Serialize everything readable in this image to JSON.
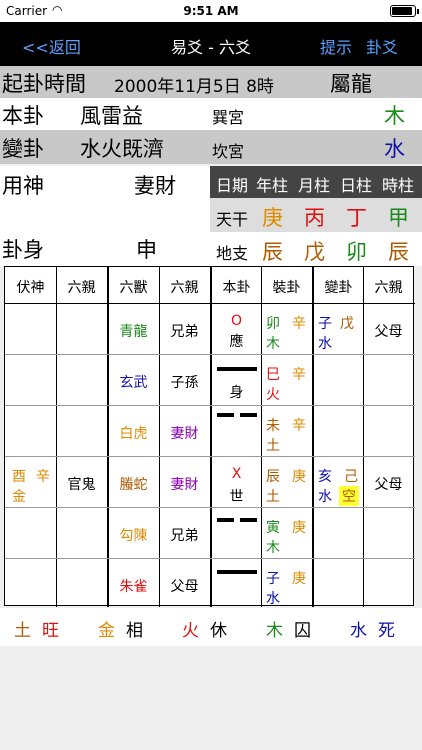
{
  "status": {
    "carrier": "Carrier",
    "time": "9:51 AM"
  },
  "nav": {
    "back": "<<返回",
    "title": "易爻 - 六爻",
    "hint": "提示",
    "gua_yao": "卦爻"
  },
  "info": {
    "time_label": "起卦時間",
    "time_value": "2000年11月5日 8時",
    "zodiac": "屬龍",
    "bengua_label": "本卦",
    "bengua_value": "風雷益",
    "bengua_palace": "巽宮",
    "bengua_element": "木",
    "biangua_label": "變卦",
    "biangua_value": "水火既濟",
    "biangua_palace": "坎宮",
    "biangua_element": "水",
    "yongshen_label": "用神",
    "yongshen_value": "妻財",
    "guashen_label": "卦身",
    "guashen_value": "申"
  },
  "pillars": {
    "headers": [
      "日期",
      "年柱",
      "月柱",
      "日柱",
      "時柱"
    ],
    "stem_label": "天干",
    "stems": [
      "庚",
      "丙",
      "丁",
      "甲"
    ],
    "branch_label": "地支",
    "branches": [
      "辰",
      "戊",
      "卯",
      "辰"
    ]
  },
  "table": {
    "headers": [
      "伏神",
      "六親",
      "六獸",
      "六親",
      "本卦",
      "裝卦",
      "變卦",
      "六親"
    ],
    "rows": [
      {
        "fushen": [
          "",
          ""
        ],
        "fu_liuqin": "",
        "beast": "青龍",
        "liuqin": "兄弟",
        "mark": "O",
        "sub": "應",
        "line": "yang",
        "zhuang": [
          "卯",
          "辛",
          "木"
        ],
        "bian": [
          "子",
          "戊",
          "水"
        ],
        "bian_liuqin": "父母"
      },
      {
        "fushen": [
          "",
          ""
        ],
        "fu_liuqin": "",
        "beast": "玄武",
        "liuqin": "子孫",
        "mark": "",
        "sub": "身",
        "line": "yang",
        "zhuang": [
          "巳",
          "辛",
          "火"
        ],
        "bian": [
          "",
          "",
          ""
        ],
        "bian_liuqin": ""
      },
      {
        "fushen": [
          "",
          ""
        ],
        "fu_liuqin": "",
        "beast": "白虎",
        "liuqin": "妻財",
        "mark": "",
        "sub": "",
        "line": "yin",
        "zhuang": [
          "未",
          "辛",
          "土"
        ],
        "bian": [
          "",
          "",
          ""
        ],
        "bian_liuqin": ""
      },
      {
        "fushen": [
          "酉",
          "辛",
          "金"
        ],
        "fu_liuqin": "官鬼",
        "beast": "螣蛇",
        "liuqin": "妻財",
        "mark": "X",
        "sub": "世",
        "line": "yin",
        "zhuang": [
          "辰",
          "庚",
          "土"
        ],
        "bian": [
          "亥",
          "己",
          "水"
        ],
        "bian_void": "空",
        "bian_liuqin": "父母"
      },
      {
        "fushen": [
          "",
          ""
        ],
        "fu_liuqin": "",
        "beast": "勾陳",
        "liuqin": "兄弟",
        "mark": "",
        "sub": "",
        "line": "yin",
        "zhuang": [
          "寅",
          "庚",
          "木"
        ],
        "bian": [
          "",
          "",
          ""
        ],
        "bian_liuqin": ""
      },
      {
        "fushen": [
          "",
          ""
        ],
        "fu_liuqin": "",
        "beast": "朱雀",
        "liuqin": "父母",
        "mark": "",
        "sub": "",
        "line": "yang",
        "zhuang": [
          "子",
          "庚",
          "水"
        ],
        "bian": [
          "",
          "",
          ""
        ],
        "bian_liuqin": ""
      }
    ]
  },
  "strength": [
    {
      "element": "土",
      "state": "旺"
    },
    {
      "element": "金",
      "state": "相"
    },
    {
      "element": "火",
      "state": "休"
    },
    {
      "element": "木",
      "state": "囚"
    },
    {
      "element": "水",
      "state": "死"
    }
  ],
  "colors": {
    "wood": "#1a8a1a",
    "water": "#1010aa",
    "fire": "#e01010",
    "earth": "#b05a00",
    "metal": "#e08a00",
    "purple": "#8a00b0",
    "link": "#5aa0ff"
  }
}
